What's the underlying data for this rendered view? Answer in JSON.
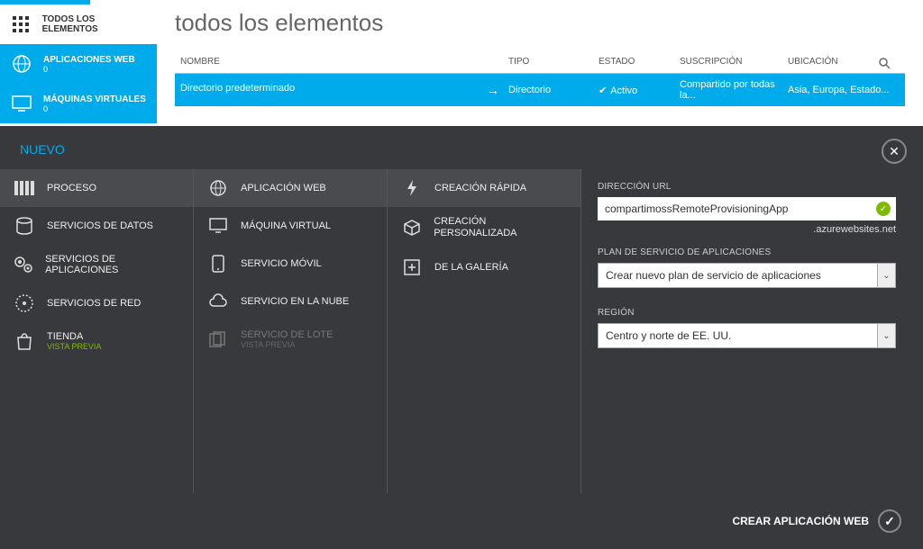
{
  "sidebar": {
    "items": [
      {
        "label": "TODOS LOS ELEMENTOS",
        "count": ""
      },
      {
        "label": "APLICACIONES WEB",
        "count": "0"
      },
      {
        "label": "MÁQUINAS VIRTUALES",
        "count": "0"
      }
    ]
  },
  "page": {
    "title": "todos los elementos"
  },
  "table": {
    "headers": {
      "nombre": "NOMBRE",
      "tipo": "TIPO",
      "estado": "ESTADO",
      "suscripcion": "SUSCRIPCIÓN",
      "ubicacion": "UBICACIÓN"
    },
    "rows": [
      {
        "nombre": "Directorio predeterminado",
        "tipo": "Directorio",
        "estado": "Activo",
        "suscripcion": "Compartido por todas la...",
        "ubicacion": "Asia, Europa, Estado..."
      }
    ]
  },
  "modal": {
    "title": "NUEVO",
    "col1": [
      {
        "label": "PROCESO"
      },
      {
        "label": "SERVICIOS DE DATOS"
      },
      {
        "label": "SERVICIOS DE APLICACIONES"
      },
      {
        "label": "SERVICIOS DE RED"
      },
      {
        "label": "TIENDA",
        "sub": "VISTA PREVIA"
      }
    ],
    "col2": [
      {
        "label": "APLICACIÓN WEB"
      },
      {
        "label": "MÁQUINA VIRTUAL"
      },
      {
        "label": "SERVICIO MÓVIL"
      },
      {
        "label": "SERVICIO EN LA NUBE"
      },
      {
        "label": "SERVICIO DE LOTE",
        "sub": "VISTA PREVIA"
      }
    ],
    "col3": [
      {
        "label": "CREACIÓN RÁPIDA"
      },
      {
        "label": "CREACIÓN PERSONALIZADA"
      },
      {
        "label": "DE LA GALERÍA"
      }
    ],
    "form": {
      "url_label": "DIRECCIÓN URL",
      "url_value": "compartimossRemoteProvisioningApp",
      "url_suffix": ".azurewebsites.net",
      "plan_label": "PLAN DE SERVICIO DE APLICACIONES",
      "plan_value": "Crear nuevo plan de servicio de aplicaciones",
      "region_label": "REGIÓN",
      "region_value": "Centro y norte de EE. UU."
    },
    "footer": "CREAR APLICACIÓN WEB"
  }
}
